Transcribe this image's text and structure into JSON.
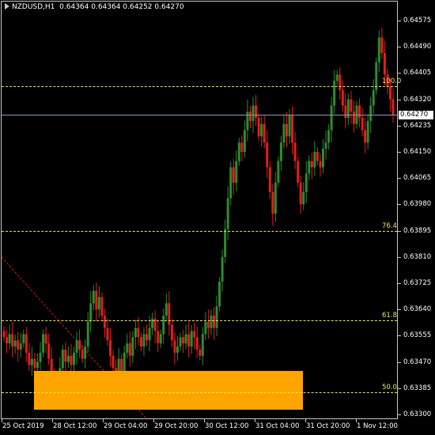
{
  "header": {
    "symbol": "NZDUSD,H1",
    "quote": "0.64364 0.64364 0.64252 0.64270"
  },
  "colors": {
    "background": "#000000",
    "bull": "#2e8b2e",
    "bear": "#e01e1e",
    "fib": "#e8e84a",
    "zone": "#ffa500",
    "trend": "#c81e1e"
  },
  "current_price": "0.64270",
  "fib_levels": [
    {
      "label": "100.0",
      "price": 0.64362
    },
    {
      "label": "76.4",
      "price": 0.63895
    },
    {
      "label": "61.8",
      "price": 0.63605
    },
    {
      "label": "50.0",
      "price": 0.63372
    }
  ],
  "zone": {
    "from_price": 0.6344,
    "to_price": 0.63315
  },
  "chart_data": {
    "type": "candlestick",
    "ylim": [
      0.633,
      0.646
    ],
    "y_ticks": [
      "0.64575",
      "0.64490",
      "0.64405",
      "0.64320",
      "0.64235",
      "0.64150",
      "0.64065",
      "0.63980",
      "0.63895",
      "0.63810",
      "0.63725",
      "0.63640",
      "0.63555",
      "0.63470",
      "0.63385",
      "0.63300"
    ],
    "x_labels": [
      "25 Oct 2019",
      "28 Oct 12:00",
      "29 Oct 04:00",
      "29 Oct 20:00",
      "30 Oct 12:00",
      "31 Oct 04:00",
      "31 Oct 20:00",
      "1 Nov 12:00"
    ],
    "closes": [
      0.6355,
      0.6353,
      0.6356,
      0.6352,
      0.6354,
      0.6351,
      0.6353,
      0.6356,
      0.635,
      0.6346,
      0.6348,
      0.6345,
      0.6347,
      0.635,
      0.6356,
      0.6353,
      0.6348,
      0.6343,
      0.6341,
      0.6339,
      0.6345,
      0.6351,
      0.6347,
      0.6349,
      0.6346,
      0.635,
      0.6354,
      0.6351,
      0.6348,
      0.6352,
      0.636,
      0.6366,
      0.637,
      0.6364,
      0.6368,
      0.6362,
      0.6358,
      0.6354,
      0.6349,
      0.6345,
      0.6343,
      0.6348,
      0.6344,
      0.635,
      0.6353,
      0.6349,
      0.6355,
      0.6358,
      0.6355,
      0.6352,
      0.6356,
      0.6354,
      0.6358,
      0.6361,
      0.6357,
      0.6353,
      0.6356,
      0.6362,
      0.6366,
      0.6359,
      0.6354,
      0.635,
      0.6352,
      0.6355,
      0.6353,
      0.6356,
      0.6352,
      0.6357,
      0.6355,
      0.6351,
      0.6349,
      0.6356,
      0.636,
      0.6358,
      0.6362,
      0.6358,
      0.6365,
      0.6373,
      0.6381,
      0.639,
      0.64,
      0.641,
      0.6405,
      0.6412,
      0.6418,
      0.6415,
      0.6422,
      0.6428,
      0.6425,
      0.643,
      0.6426,
      0.642,
      0.6424,
      0.6418,
      0.641,
      0.6402,
      0.6395,
      0.6405,
      0.6412,
      0.6418,
      0.6424,
      0.642,
      0.6427,
      0.6418,
      0.6412,
      0.6405,
      0.6398,
      0.6402,
      0.6408,
      0.6412,
      0.641,
      0.6415,
      0.6412,
      0.641,
      0.6416,
      0.6418,
      0.6422,
      0.643,
      0.6438,
      0.644,
      0.6435,
      0.643,
      0.6426,
      0.6432,
      0.6428,
      0.6424,
      0.643,
      0.6426,
      0.6422,
      0.6418,
      0.6425,
      0.643,
      0.6435,
      0.6444,
      0.6452,
      0.6447,
      0.644,
      0.6436,
      0.6432,
      0.6427
    ]
  }
}
